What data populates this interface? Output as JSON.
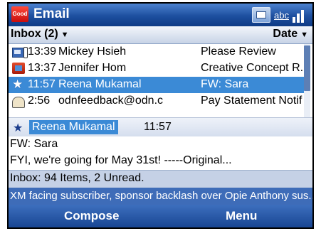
{
  "app": {
    "logo_text": "Good",
    "title": "Email",
    "input_mode": "abc"
  },
  "header": {
    "folder_label": "Inbox (2)",
    "sort_label": "Date"
  },
  "messages": [
    {
      "icon": "envelope-attachment-icon",
      "time": "13:39",
      "sender": "Mickey Hsieh",
      "subject": "Please Review"
    },
    {
      "icon": "meeting-request-icon",
      "time": "13:37",
      "sender": "Jennifer Hom",
      "subject": "Creative Concept R..."
    },
    {
      "icon": "star-icon",
      "time": "11:57",
      "sender": "Reena Mukamal",
      "subject": "FW: Sara",
      "selected": true
    },
    {
      "icon": "partial-icon",
      "time": "2:56",
      "sender": "odnfeedback@odn.c",
      "subject": "Pay Statement Notif"
    }
  ],
  "preview": {
    "sender": "Reena Mukamal",
    "time": "11:57",
    "subject": "FW: Sara",
    "body": "FYI, we're going for May 31st! -----Original..."
  },
  "status": {
    "inbox_summary": "Inbox: 94 Items, 2 Unread."
  },
  "ticker": {
    "text": "XM facing subscriber, sponsor backlash over Opie Anthony sus..."
  },
  "softkeys": {
    "left": "Compose",
    "right": "Menu"
  },
  "colors": {
    "titlebar": "#1d4f9f",
    "selection": "#3b8ad6",
    "ticker": "#3e6cb8",
    "good_logo": "#c80d0d"
  }
}
